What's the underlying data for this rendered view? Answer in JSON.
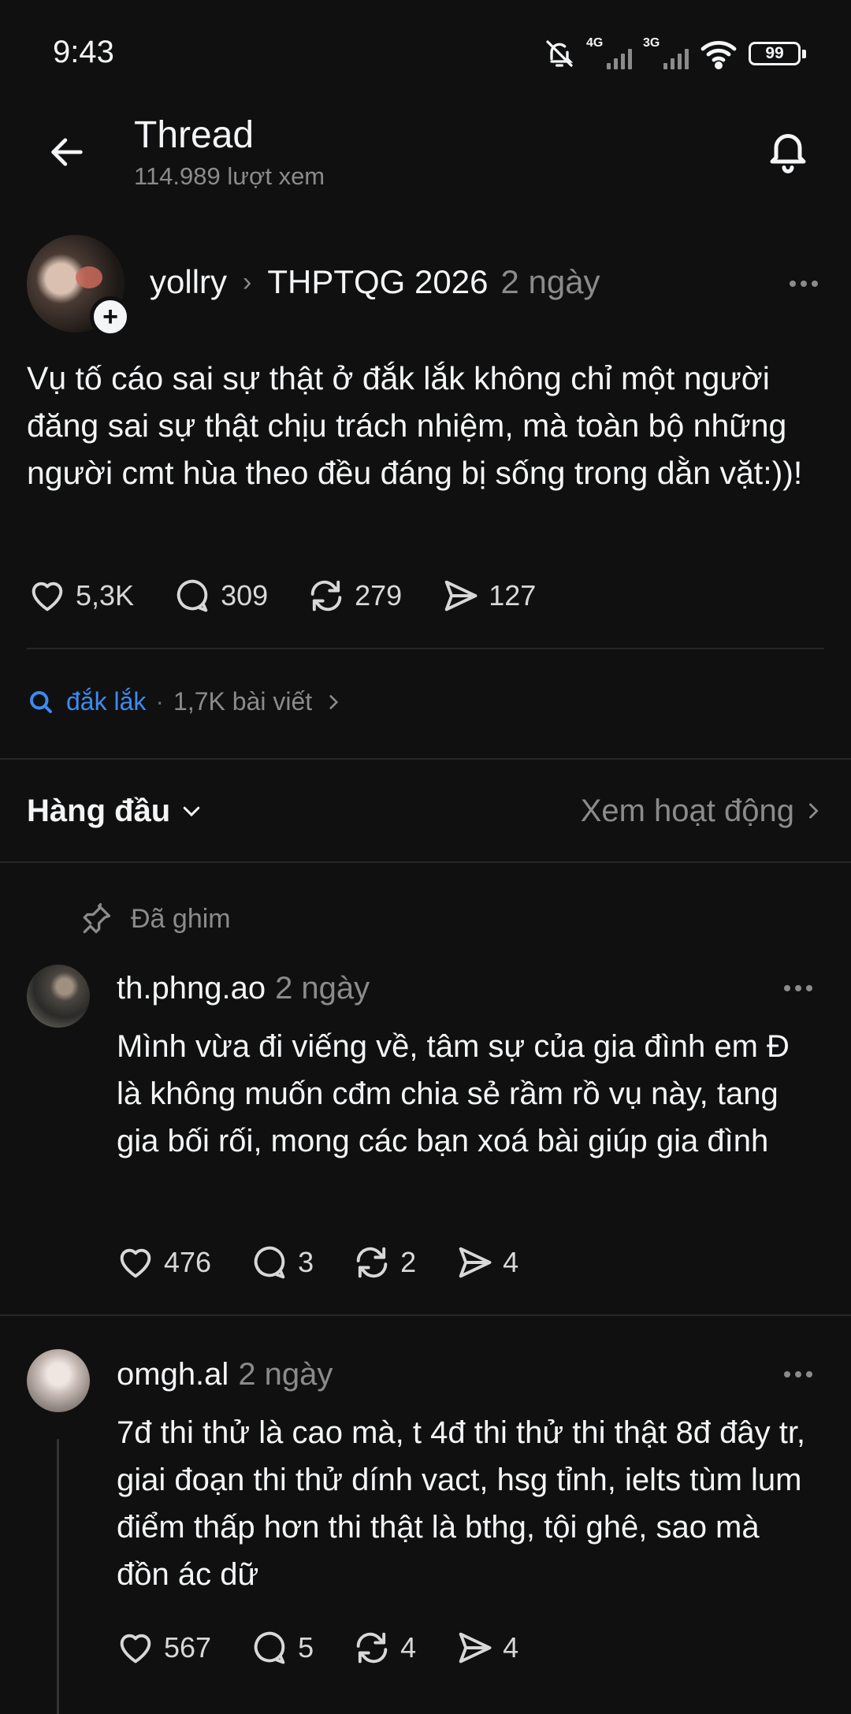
{
  "status_bar": {
    "time": "9:43",
    "net1": "4G",
    "net2": "3G",
    "battery": "99"
  },
  "header": {
    "title": "Thread",
    "views": "114.989 lượt xem"
  },
  "post": {
    "username": "yollry",
    "community": "THPTQG 2026",
    "time": "2 ngày",
    "text": "Vụ tố cáo sai sự thật ở đắk lắk không chỉ một người đăng sai sự thật chịu trách nhiệm, mà toàn bộ những người cmt hùa theo đều đáng bị sống trong dằn vặt:))!",
    "likes": "5,3K",
    "comments": "309",
    "reposts": "279",
    "shares": "127"
  },
  "topic": {
    "tag": "đắk lắk",
    "sep": "·",
    "count": "1,7K bài viết"
  },
  "sort": {
    "label": "Hàng đầu",
    "activity": "Xem hoạt động"
  },
  "pinned_label": "Đã ghim",
  "replies": [
    {
      "username": "th.phng.ao",
      "time": "2 ngày",
      "text": "Mình vừa đi viếng về, tâm sự của gia đình em Đ là không muốn cđm chia sẻ rầm rồ vụ này, tang gia bối rối, mong các bạn xoá bài giúp gia đình",
      "likes": "476",
      "comments": "3",
      "reposts": "2",
      "shares": "4"
    },
    {
      "username": "omgh.al",
      "time": "2 ngày",
      "text": "7đ thi thử là cao mà, t 4đ thi thử thi thật 8đ đây tr, giai đoạn thi thử dính vact, hsg tỉnh, ielts tùm lum điểm thấp hơn thi thật là bthg, tội ghê, sao mà đồn ác dữ",
      "likes": "567",
      "comments": "5",
      "reposts": "4",
      "shares": "4"
    }
  ],
  "colors": {
    "background": "#101010",
    "text": "#f3f5f7",
    "muted": "#8b8b8b",
    "link": "#3d8bf2"
  }
}
